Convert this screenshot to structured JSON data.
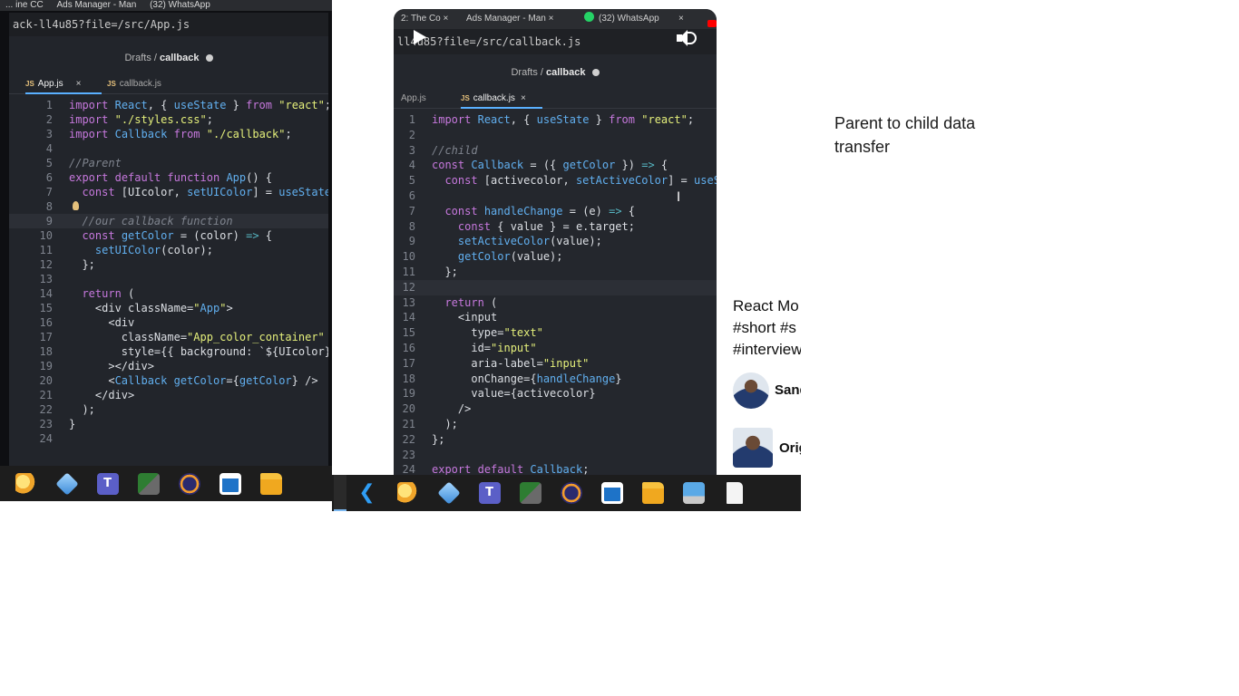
{
  "left_screen": {
    "browser_tabs": [
      "... ine CC",
      "Ads Manager - Man",
      "(32) WhatsApp"
    ],
    "url": "ack-ll4u85?file=/src/App.js",
    "breadcrumb": {
      "folder": "Drafts",
      "separator": "/",
      "file": "callback"
    },
    "editor_tabs": [
      {
        "badge": "JS",
        "label": "App.js",
        "close": "×"
      },
      {
        "badge": "JS",
        "label": "callback.js"
      }
    ],
    "code_lines": [
      {
        "n": "1",
        "t": "import React, { useState } from \"react\";"
      },
      {
        "n": "2",
        "t": "import \"./styles.css\";"
      },
      {
        "n": "3",
        "t": "import Callback from \"./callback\";"
      },
      {
        "n": "4",
        "t": ""
      },
      {
        "n": "5",
        "t": "//Parent"
      },
      {
        "n": "6",
        "t": "export default function App() {"
      },
      {
        "n": "7",
        "t": "  const [UIcolor, setUIColor] = useState("
      },
      {
        "n": "8",
        "t": ""
      },
      {
        "n": "9",
        "t": "  //our callback function"
      },
      {
        "n": "10",
        "t": "  const getColor = (color) => {"
      },
      {
        "n": "11",
        "t": "    setUIColor(color);"
      },
      {
        "n": "12",
        "t": "  };"
      },
      {
        "n": "13",
        "t": ""
      },
      {
        "n": "14",
        "t": "  return ("
      },
      {
        "n": "15",
        "t": "    <div className=\"App\">"
      },
      {
        "n": "16",
        "t": "      <div"
      },
      {
        "n": "17",
        "t": "        className=\"App_color_container\""
      },
      {
        "n": "18",
        "t": "        style={{ background: `${UIcolor}` }"
      },
      {
        "n": "19",
        "t": "      ></div>"
      },
      {
        "n": "20",
        "t": "      <Callback getColor={getColor} />"
      },
      {
        "n": "21",
        "t": "    </div>"
      },
      {
        "n": "22",
        "t": "  );"
      },
      {
        "n": "23",
        "t": "}"
      },
      {
        "n": "24",
        "t": ""
      }
    ]
  },
  "video": {
    "browser_tabs": [
      "2: The Co",
      "Ads Manager - Man",
      "(32) WhatsApp"
    ],
    "tab_close": "×",
    "url": "ll4u85?file=/src/callback.js",
    "breadcrumb": {
      "folder": "Drafts",
      "separator": "/",
      "file": "callback"
    },
    "editor_tabs": [
      {
        "label": "App.js"
      },
      {
        "badge": "JS",
        "label": "callback.js",
        "close": "×"
      }
    ],
    "code_lines": [
      {
        "n": "1",
        "t": "import React, { useState } from \"react\";"
      },
      {
        "n": "2",
        "t": ""
      },
      {
        "n": "3",
        "t": "//child"
      },
      {
        "n": "4",
        "t": "const Callback = ({ getColor }) => {"
      },
      {
        "n": "5",
        "t": "  const [activecolor, setActiveColor] = useSt"
      },
      {
        "n": "6",
        "t": ""
      },
      {
        "n": "7",
        "t": "  const handleChange = (e) => {"
      },
      {
        "n": "8",
        "t": "    const { value } = e.target;"
      },
      {
        "n": "9",
        "t": "    setActiveColor(value);"
      },
      {
        "n": "10",
        "t": "    getColor(value);"
      },
      {
        "n": "11",
        "t": "  };"
      },
      {
        "n": "12",
        "t": ""
      },
      {
        "n": "13",
        "t": "  return ("
      },
      {
        "n": "14",
        "t": "    <input"
      },
      {
        "n": "15",
        "t": "      type=\"text\""
      },
      {
        "n": "16",
        "t": "      id=\"input\""
      },
      {
        "n": "17",
        "t": "      aria-label=\"input\""
      },
      {
        "n": "18",
        "t": "      onChange={handleChange}"
      },
      {
        "n": "19",
        "t": "      value={activecolor}"
      },
      {
        "n": "20",
        "t": "    />"
      },
      {
        "n": "21",
        "t": "  );"
      },
      {
        "n": "22",
        "t": "};"
      },
      {
        "n": "23",
        "t": ""
      },
      {
        "n": "24",
        "t": "export default Callback;"
      }
    ]
  },
  "taskbar_left": [
    "sky-app-icon",
    "cube-app-icon",
    "teams-icon",
    "vpn-lock-icon",
    "eclipse-icon",
    "window-app-icon",
    "file-explorer-icon"
  ],
  "taskbar_right": [
    "vscode-icon",
    "sky-app-icon",
    "cube-app-icon",
    "teams-icon",
    "vpn-lock-icon",
    "eclipse-icon",
    "window-app-icon",
    "file-explorer-icon",
    "this-pc-icon",
    "blank-file-icon"
  ],
  "short_info": {
    "title": "React Mo\n#short #s\n#interview",
    "channel_1": "Sand",
    "channel_2": "Orig"
  },
  "caption": "Parent to child data transfer"
}
